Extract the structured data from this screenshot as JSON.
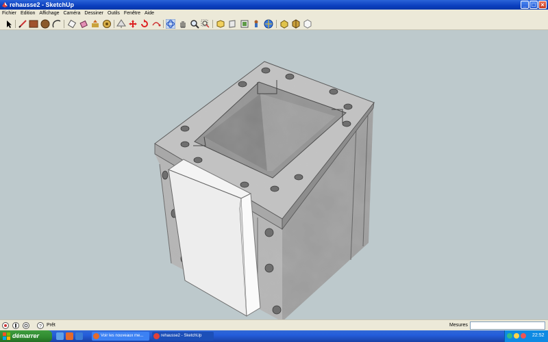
{
  "window": {
    "title": "rehausse2 - SketchUp"
  },
  "menu": {
    "items": [
      "Fichier",
      "Edition",
      "Affichage",
      "Caméra",
      "Dessiner",
      "Outils",
      "Fenêtre",
      "Aide"
    ]
  },
  "toolbar": {
    "tools": [
      "select-icon",
      "pencil-icon",
      "rectangle-icon",
      "circle-icon",
      "arc-icon",
      "eraser-icon",
      "paint-bucket-icon",
      "push-pull-icon",
      "follow-me-icon",
      "offset-icon",
      "move-icon",
      "rotate-icon",
      "scale-icon",
      "orbit-icon",
      "pan-icon",
      "zoom-icon",
      "zoom-extents-icon",
      "zoom-window-icon",
      "previous-view-icon",
      "tape-measure-icon",
      "protractor-icon",
      "text-icon",
      "axes-icon",
      "section-icon",
      "components-icon",
      "materials-icon"
    ]
  },
  "status": {
    "text": "Prêt",
    "measure_label": "Mesures",
    "measure_value": ""
  },
  "taskbar": {
    "start_label": "démarrer",
    "tasks": [
      {
        "label": "Voir les nouveaux me..."
      },
      {
        "label": "rehausse2 - SketchUp"
      }
    ],
    "clock": "22:52"
  },
  "colors": {
    "viewport_bg": "#bdc9cc",
    "model_gray": "#a5a5a5",
    "accent_title": "#0a3fbf"
  }
}
